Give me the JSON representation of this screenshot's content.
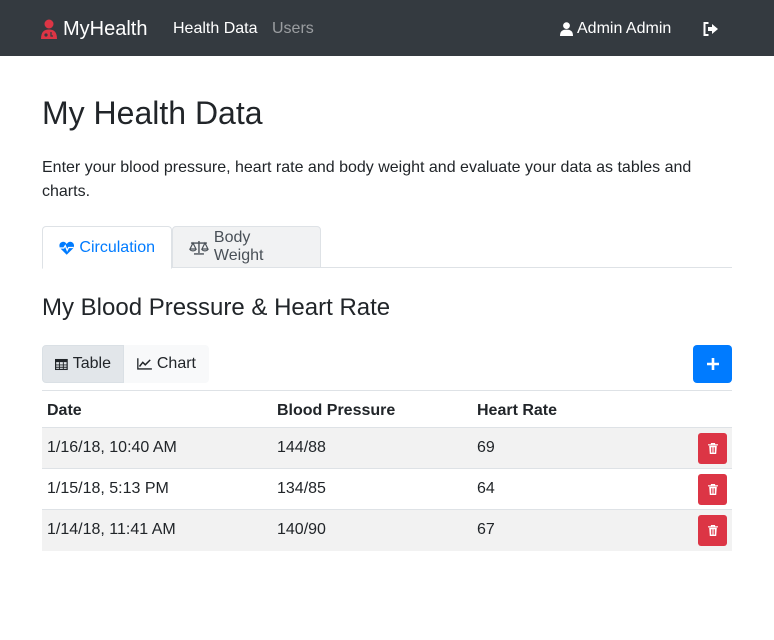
{
  "navbar": {
    "brand": "MyHealth",
    "links": [
      {
        "label": "Health Data",
        "active": true
      },
      {
        "label": "Users",
        "active": false
      }
    ],
    "user": "Admin Admin",
    "colors": {
      "background": "#343a40",
      "active": "#ffffff",
      "brand_icon": "#dc3545"
    }
  },
  "page": {
    "title": "My Health Data",
    "lead": "Enter your blood pressure, heart rate and body weight and evaluate your data as tables and charts."
  },
  "tabs": [
    {
      "label": "Circulation",
      "icon": "heartbeat-icon",
      "active": true
    },
    {
      "label": "Body Weight",
      "icon": "balance-scale-icon",
      "active": false
    }
  ],
  "section": {
    "title": "My Blood Pressure & Heart Rate",
    "view_toggle": [
      {
        "label": "Table",
        "icon": "table-icon",
        "active": true
      },
      {
        "label": "Chart",
        "icon": "line-chart-icon",
        "active": false
      }
    ],
    "add_icon": "plus-icon"
  },
  "table": {
    "headers": [
      "Date",
      "Blood Pressure",
      "Heart Rate"
    ],
    "rows": [
      {
        "date": "1/16/18, 10:40 AM",
        "bp": "144/88",
        "hr": "69"
      },
      {
        "date": "1/15/18, 5:13 PM",
        "bp": "134/85",
        "hr": "64"
      },
      {
        "date": "1/14/18, 11:41 AM",
        "bp": "140/90",
        "hr": "67"
      }
    ],
    "delete_icon": "trash-icon",
    "colors": {
      "delete": "#dc3545",
      "add": "#007bff",
      "link": "#007bff"
    }
  }
}
